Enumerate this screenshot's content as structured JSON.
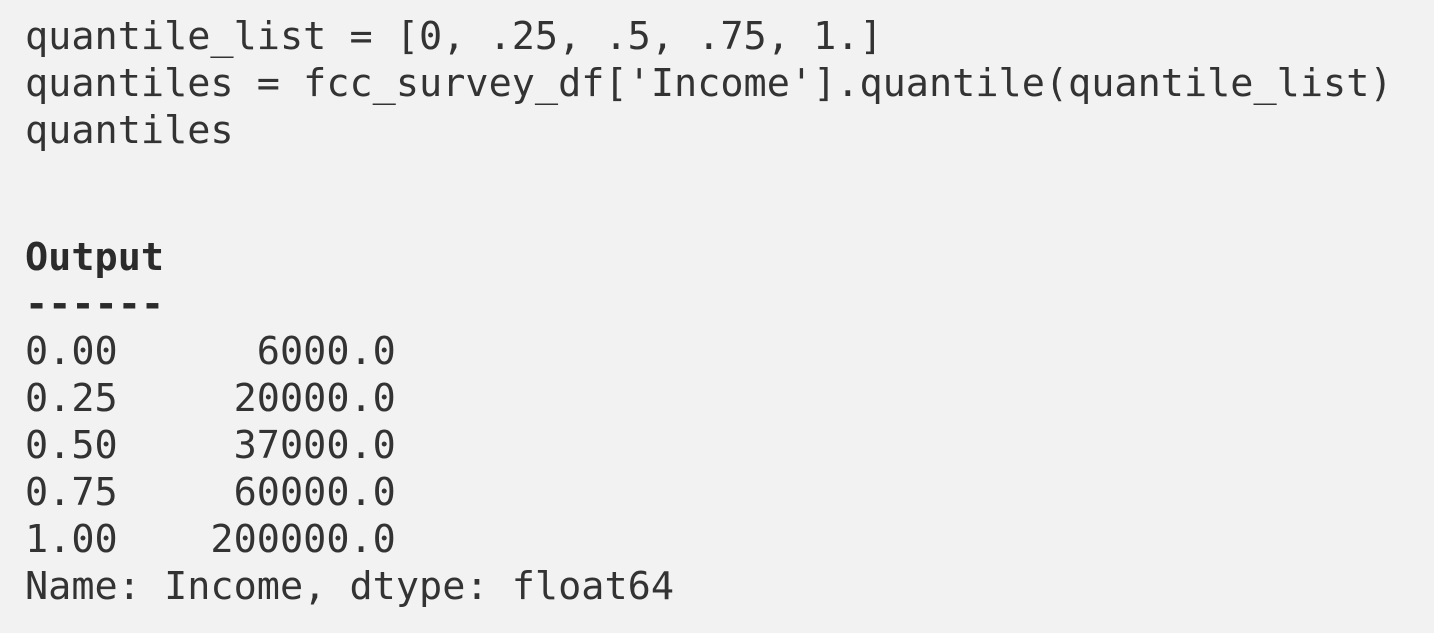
{
  "code": {
    "lines": [
      "quantile_list = [0, .25, .5, .75, 1.]",
      "quantiles = fcc_survey_df['Income'].quantile(quantile_list)",
      "quantiles"
    ]
  },
  "output": {
    "label": "Output",
    "rule": "------",
    "rows": [
      "0.00      6000.0",
      "0.25     20000.0",
      "0.50     37000.0",
      "0.75     60000.0",
      "1.00    200000.0"
    ],
    "footer": "Name: Income, dtype: float64"
  }
}
